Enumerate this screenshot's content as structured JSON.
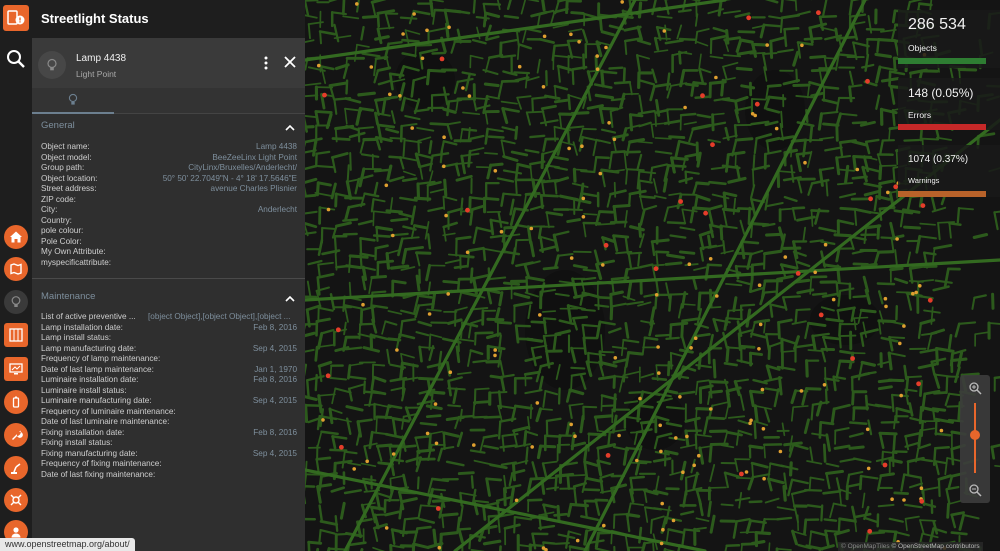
{
  "app": {
    "title": "Streetlight Status"
  },
  "object": {
    "name": "Lamp 4438",
    "type": "Light Point"
  },
  "general": {
    "heading": "General",
    "rows": [
      {
        "key": "Object name:",
        "value": "Lamp 4438"
      },
      {
        "key": "Object model:",
        "value": "BeeZeeLinx Light Point"
      },
      {
        "key": "Group path:",
        "value": "CityLinx/Bruxelles/Anderlecht/"
      },
      {
        "key": "Object location:",
        "value": "50° 50' 22.7049\"N - 4° 18' 17.5646\"E"
      },
      {
        "key": "Street address:",
        "value": "avenue Charles Plisnier"
      },
      {
        "key": "ZIP code:",
        "value": ""
      },
      {
        "key": "City:",
        "value": "Anderlecht"
      },
      {
        "key": "Country:",
        "value": ""
      },
      {
        "key": "pole colour:",
        "value": ""
      },
      {
        "key": "Pole Color:",
        "value": ""
      },
      {
        "key": "My Own Attribute:",
        "value": ""
      },
      {
        "key": "myspecificattribute:",
        "value": ""
      }
    ]
  },
  "maintenance": {
    "heading": "Maintenance",
    "rows": [
      {
        "key": "List of active preventive ...",
        "value": "[object Object],[object Object],[object ..."
      },
      {
        "key": "Lamp installation date:",
        "value": "Feb 8, 2016"
      },
      {
        "key": "Lamp install status:",
        "value": ""
      },
      {
        "key": "Lamp manufacturing date:",
        "value": "Sep 4, 2015"
      },
      {
        "key": "Frequency of lamp maintenance:",
        "value": ""
      },
      {
        "key": "Date of last lamp maintenance:",
        "value": "Jan 1, 1970"
      },
      {
        "key": "Luminaire installation date:",
        "value": "Feb 8, 2016"
      },
      {
        "key": "Luminaire install status:",
        "value": ""
      },
      {
        "key": "Luminaire manufacturing date:",
        "value": "Sep 4, 2015"
      },
      {
        "key": "Frequency of luminaire maintenance:",
        "value": ""
      },
      {
        "key": "Date of last luminaire maintenance:",
        "value": ""
      },
      {
        "key": "Fixing installation date:",
        "value": "Feb 8, 2016"
      },
      {
        "key": "Fixing install status:",
        "value": ""
      },
      {
        "key": "Fixing manufacturing date:",
        "value": "Sep 4, 2015"
      },
      {
        "key": "Frequency of fixing maintenance:",
        "value": ""
      },
      {
        "key": "Date of last fixing maintenance:",
        "value": ""
      }
    ]
  },
  "stats": {
    "objects": {
      "value": "286 534",
      "label": "Objects",
      "color": "#2e7d32"
    },
    "errors": {
      "value": "148 (0.05%)",
      "label": "Errors",
      "color": "#c62828"
    },
    "warnings": {
      "value": "1074 (0.37%)",
      "label": "Warnings",
      "color": "#b8622a"
    }
  },
  "map": {
    "road_color": "#2c5a1c",
    "background_color": "#141414",
    "error_color": "#e53d2a",
    "warning_color": "#e0a030",
    "zoom_level_fraction": 0.45
  },
  "attribution": {
    "part1": "© OpenMapTiles",
    "part2": "© OpenStreetMap contributors"
  },
  "status_url": "www.openstreetmap.org/about/",
  "rail_icons": [
    "logo-icon",
    "search-icon",
    "home-icon",
    "map-layers-icon",
    "lightbulb-icon",
    "cabinet-icon",
    "monitor-icon",
    "battery-icon",
    "wrench-icon",
    "robot-arm-icon",
    "settings-cross-icon",
    "user-icon"
  ],
  "colors": {
    "accent": "#e8662b",
    "panel": "#2f2f2f",
    "section_heading": "#7d8e9c"
  }
}
